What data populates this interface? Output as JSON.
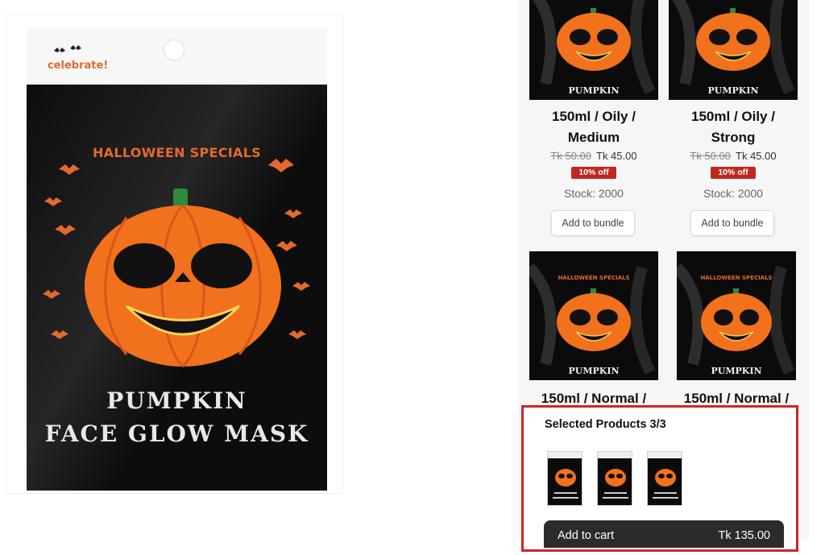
{
  "main_image": {
    "brand_text": "celebrate!",
    "special_text": "HALLOWEEN SPECIALS",
    "title_line1": "PUMPKIN",
    "title_line2": "FACE GLOW MASK"
  },
  "thumb_label": "PUMPKIN",
  "thumb_special": "HALLOWEEN SPECIALS",
  "products": [
    {
      "title_line1": "150ml / Oily /",
      "title_line2": "Medium",
      "old_price": "Tk 50.00",
      "price": "Tk 45.00",
      "discount": "10% off",
      "stock": "Stock: 2000",
      "button": "Add to bundle"
    },
    {
      "title_line1": "150ml / Oily /",
      "title_line2": "Strong",
      "old_price": "Tk 50.00",
      "price": "Tk 45.00",
      "discount": "10% off",
      "stock": "Stock: 2000",
      "button": "Add to bundle"
    },
    {
      "title_line1": "150ml / Normal /"
    },
    {
      "title_line1": "150ml / Normal /"
    }
  ],
  "selected": {
    "title": "Selected Products 3/3",
    "count": 3,
    "add_to_cart": "Add to cart",
    "total": "Tk 135.00"
  },
  "colors": {
    "accent_red": "#d2232a",
    "badge_red": "#c0281f",
    "pumpkin_orange": "#f2711c",
    "pack_black": "#0d0d0d",
    "cart_button": "#2b2b2b"
  },
  "icons": [
    "zoom-icon",
    "bat-icon",
    "pumpkin-icon"
  ]
}
